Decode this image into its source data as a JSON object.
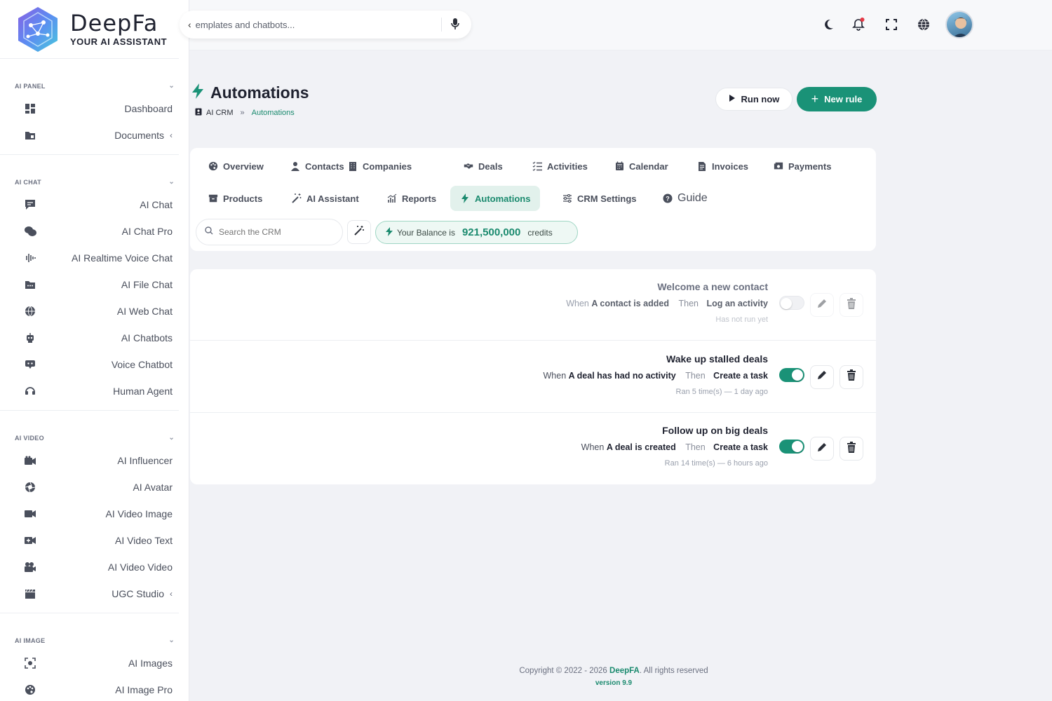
{
  "brand": {
    "title": "DeepFa",
    "subtitle": "YOUR AI ASSISTANT"
  },
  "sidebar": {
    "sections": [
      {
        "title": "AI PANEL",
        "items": [
          {
            "label": "Dashboard",
            "icon": "dashboard-icon"
          },
          {
            "label": "Documents",
            "icon": "folder-icon",
            "caret": "‹"
          }
        ]
      },
      {
        "title": "AI CHAT",
        "items": [
          {
            "label": "AI Chat",
            "icon": "chat-icon"
          },
          {
            "label": "AI Chat Pro",
            "icon": "chats-icon"
          },
          {
            "label": "AI Realtime Voice Chat",
            "icon": "waveform-icon"
          },
          {
            "label": "AI File Chat",
            "icon": "folder-dots-icon"
          },
          {
            "label": "AI Web Chat",
            "icon": "globe-icon"
          },
          {
            "label": "AI Chatbots",
            "icon": "robot-icon"
          },
          {
            "label": "Voice Chatbot",
            "icon": "voice-bot-icon"
          },
          {
            "label": "Human Agent",
            "icon": "headset-icon"
          }
        ]
      },
      {
        "title": "AI VIDEO",
        "items": [
          {
            "label": "AI Influencer",
            "icon": "camera-icon"
          },
          {
            "label": "AI Avatar",
            "icon": "aperture-icon"
          },
          {
            "label": "AI Video Image",
            "icon": "video-icon"
          },
          {
            "label": "AI Video Text",
            "icon": "video-plus-icon"
          },
          {
            "label": "AI Video Video",
            "icon": "projector-icon"
          },
          {
            "label": "UGC Studio",
            "icon": "clapperboard-icon",
            "caret": "‹"
          }
        ]
      },
      {
        "title": "AI IMAGE",
        "items": [
          {
            "label": "AI Images",
            "icon": "image-scan-icon"
          },
          {
            "label": "AI Image Pro",
            "icon": "palette-icon"
          }
        ]
      }
    ]
  },
  "topbar": {
    "search_value": "emplates and chatbots..."
  },
  "page": {
    "title": "Automations",
    "breadcrumb": [
      "AI CRM",
      "Automations"
    ],
    "run_now": "Run now",
    "new_rule": "New rule"
  },
  "tabs": [
    {
      "label": "Overview",
      "icon": "palette-icon"
    },
    {
      "label": "Contacts",
      "icon": "user-icon"
    },
    {
      "label": "Companies",
      "icon": "building-icon"
    },
    {
      "label": "Deals",
      "icon": "handshake-icon"
    },
    {
      "label": "Activities",
      "icon": "list-check-icon"
    },
    {
      "label": "Calendar",
      "icon": "calendar-icon"
    },
    {
      "label": "Invoices",
      "icon": "invoice-icon"
    },
    {
      "label": "Payments",
      "icon": "money-icon"
    },
    {
      "label": "Products",
      "icon": "box-icon"
    },
    {
      "label": "AI Assistant",
      "icon": "magic-wand-icon"
    },
    {
      "label": "Reports",
      "icon": "chart-icon"
    },
    {
      "label": "Automations",
      "icon": "bolt-icon",
      "active": true
    },
    {
      "label": "CRM Settings",
      "icon": "sliders-icon"
    },
    {
      "label": "Guide",
      "icon": "question-icon"
    }
  ],
  "crm_search": {
    "placeholder": "Search the CRM"
  },
  "balance": {
    "prefix": "Your Balance is",
    "amount": "921,500,000",
    "suffix": "credits"
  },
  "rules": [
    {
      "name": "Welcome a new contact",
      "when_label": "When",
      "trigger": "A contact is added",
      "then_label": "Then",
      "action": "Log an activity",
      "meta": "Has not run yet",
      "enabled": false
    },
    {
      "name": "Wake up stalled deals",
      "when_label": "When",
      "trigger": "A deal has had no activity",
      "then_label": "Then",
      "action": "Create a task",
      "meta": "Ran 5 time(s) — 1 day ago",
      "enabled": true
    },
    {
      "name": "Follow up on big deals",
      "when_label": "When",
      "trigger": "A deal is created",
      "then_label": "Then",
      "action": "Create a task",
      "meta": "Ran 14 time(s) — 6 hours ago",
      "enabled": true
    }
  ],
  "footer": {
    "copyright": "Copyright © 2022 - 2026",
    "brand": "DeepFA",
    "rights": ". All rights reserved",
    "version": "version 9.9"
  },
  "colors": {
    "accent": "#1a9277",
    "accent_light": "#e2f1ec"
  }
}
